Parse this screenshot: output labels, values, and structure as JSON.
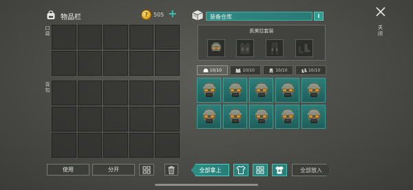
{
  "inventory": {
    "title": "物品栏",
    "bag_icon": "backpack-icon",
    "coins": "505",
    "coin_icon": "coin-icon",
    "coin_symbol": "?",
    "add_symbol": "+",
    "pocket_label": "口袋",
    "backpack_label": "背包",
    "pocket_slots": 10,
    "backpack_slots": 15,
    "use_button": "使用",
    "split_button": "分开",
    "sort_icon": "grid-sort-icon",
    "trash_icon": "trash-icon"
  },
  "storage": {
    "title": "装备仓库",
    "box_icon": "crate-icon",
    "info_label": "i",
    "set_name": "凯美拉套装",
    "set_items": [
      "helmet-icon",
      "vest-icon",
      "pants-icon",
      "boots-icon"
    ],
    "tabs": [
      {
        "icon": "helmet-icon",
        "count": "10/10",
        "active": true
      },
      {
        "icon": "vest-icon",
        "count": "10/10",
        "active": false
      },
      {
        "icon": "pants-icon",
        "count": "10/10",
        "active": false
      },
      {
        "icon": "boots-icon",
        "count": "10/10",
        "active": false
      }
    ],
    "gear_count": 10,
    "gear_item": "helmet-with-goggles-icon",
    "take_all_button": "全部拿上",
    "put_all_button": "全部放入"
  },
  "close": {
    "label": "关闭",
    "icon": "close-icon"
  },
  "colors": {
    "accent_teal": "#2f8a85",
    "teal_border": "#4fc2b8",
    "coin_gold": "#e0a821"
  }
}
